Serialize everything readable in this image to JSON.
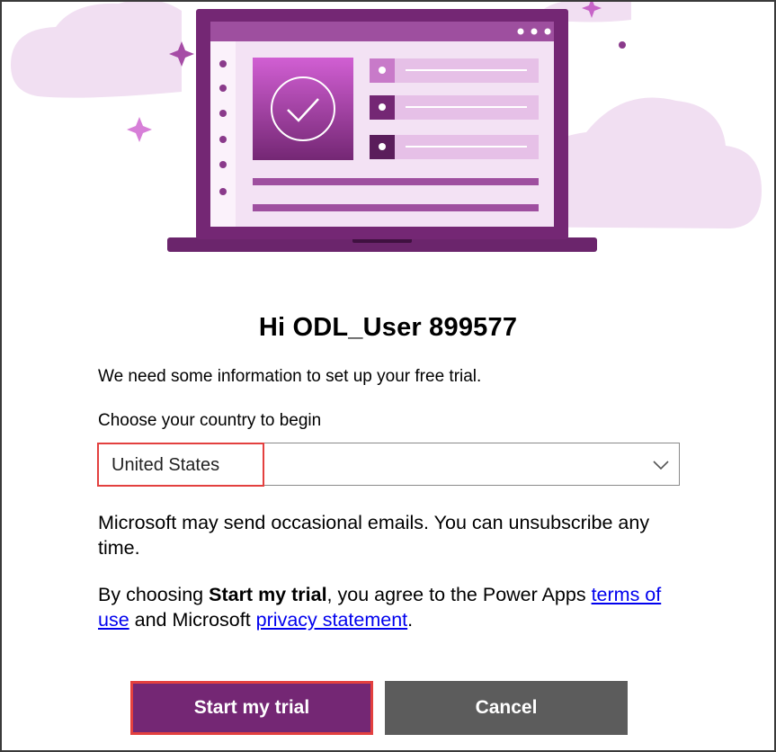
{
  "greeting": "Hi ODL_User 899577",
  "intro_text": "We need some information to set up your free trial.",
  "country": {
    "label": "Choose your country to begin",
    "selected": "United States"
  },
  "email_note": "Microsoft may send occasional emails. You can unsubscribe any time.",
  "terms": {
    "prefix": "By choosing ",
    "bold": "Start my trial",
    "middle": ", you agree to the Power Apps ",
    "terms_link": "terms of use",
    "connector": " and Microsoft ",
    "privacy_link": "privacy statement",
    "suffix": "."
  },
  "buttons": {
    "start": "Start my trial",
    "cancel": "Cancel"
  },
  "colors": {
    "brand_purple": "#742774",
    "cancel_gray": "#5c5c5c",
    "highlight_red": "#e3403f",
    "link_blue": "#0000ee"
  },
  "icons": [
    "laptop-illustration",
    "checkmark-icon",
    "sparkle-icon",
    "chevron-down-icon"
  ]
}
